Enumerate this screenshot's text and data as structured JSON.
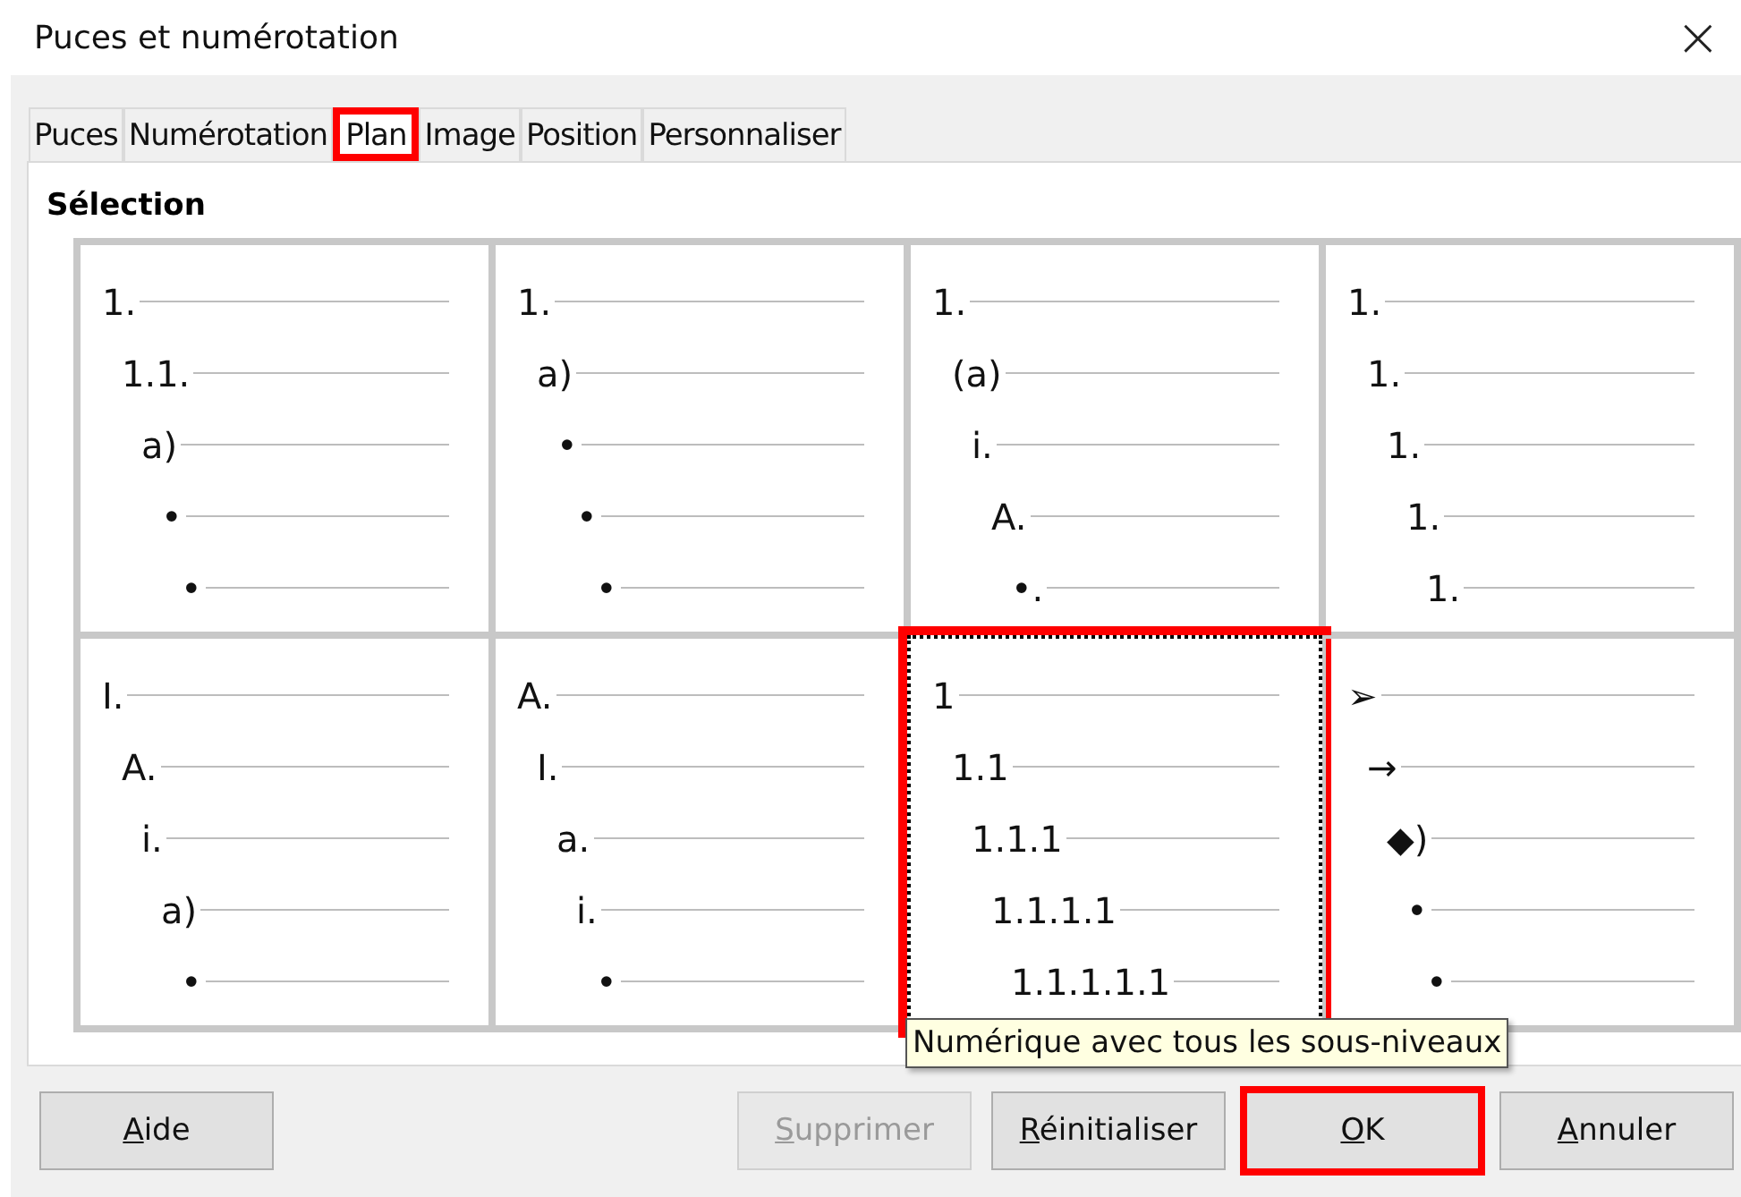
{
  "window": {
    "title": "Puces et numérotation",
    "close": "×"
  },
  "tabs": [
    {
      "label": "Puces",
      "selected": false,
      "annotated": false
    },
    {
      "label": "Numérotation",
      "selected": false,
      "annotated": false
    },
    {
      "label": "Plan",
      "selected": true,
      "annotated": true
    },
    {
      "label": "Image",
      "selected": false,
      "annotated": false
    },
    {
      "label": "Position",
      "selected": false,
      "annotated": false
    },
    {
      "label": "Personnaliser",
      "selected": false,
      "annotated": false
    }
  ],
  "section_title": "Sélection",
  "presets": [
    {
      "selected": false,
      "annotated": false,
      "items": [
        "1.",
        "1.1.",
        "a)",
        "•",
        "•"
      ]
    },
    {
      "selected": false,
      "annotated": false,
      "items": [
        "1.",
        "a)",
        "•",
        "•",
        "•"
      ]
    },
    {
      "selected": false,
      "annotated": false,
      "items": [
        "1.",
        "(a)",
        "i.",
        "A.",
        "•."
      ]
    },
    {
      "selected": false,
      "annotated": false,
      "items": [
        "1.",
        "1.",
        "1.",
        "1.",
        "1."
      ]
    },
    {
      "selected": false,
      "annotated": false,
      "items": [
        "I.",
        "A.",
        "i.",
        "a)",
        "•"
      ]
    },
    {
      "selected": false,
      "annotated": false,
      "items": [
        "A.",
        "I.",
        "a.",
        "i.",
        "•"
      ]
    },
    {
      "selected": true,
      "annotated": true,
      "items": [
        "1",
        "1.1",
        "1.1.1",
        "1.1.1.1",
        "1.1.1.1.1"
      ]
    },
    {
      "selected": false,
      "annotated": false,
      "items": [
        "➢",
        "→",
        "◆)",
        "•",
        "•"
      ]
    }
  ],
  "tooltip": "Numérique avec tous les sous-niveaux",
  "buttons": [
    {
      "label": "Aide",
      "disabled": false,
      "annotated": false
    },
    {
      "label": "Supprimer",
      "disabled": true,
      "annotated": false
    },
    {
      "label": "Réinitialiser",
      "disabled": false,
      "annotated": false
    },
    {
      "label": "OK",
      "disabled": false,
      "annotated": true
    },
    {
      "label": "Annuler",
      "disabled": false,
      "annotated": false
    }
  ]
}
